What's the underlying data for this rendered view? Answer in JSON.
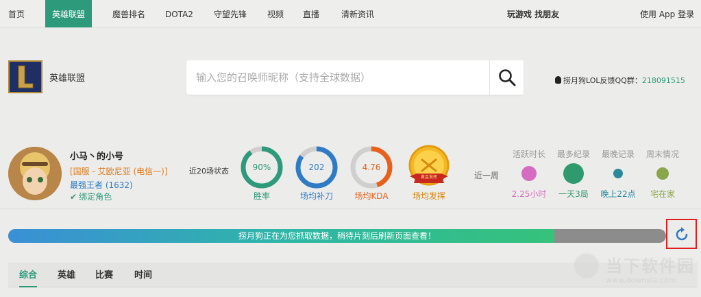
{
  "nav": {
    "items": [
      "首页",
      "英雄联盟",
      "魔兽排名",
      "DOTA2",
      "守望先锋",
      "视频",
      "直播",
      "清新资讯"
    ],
    "active_index": 1,
    "play_link": "玩游戏 找朋友",
    "app_login": "使用 App 登录"
  },
  "header": {
    "game_name": "英雄联盟",
    "search_placeholder": "输入您的召唤师昵称（支持全球数据）",
    "qq_label": "捞月狗LOL反馈QQ群：",
    "qq_number": "218091515"
  },
  "player": {
    "name": "小马丶的小号",
    "server": "[国服 - 艾欧尼亚 (电信一)]",
    "rank": "最强王者 (1632)",
    "bind": "绑定角色"
  },
  "stats": {
    "recent_label": "近20场状态",
    "win_rate": {
      "value": "90%",
      "label": "胜率",
      "fraction": 0.9,
      "color": "#2d9a7b"
    },
    "cs": {
      "value": "202",
      "label": "场均补刀",
      "fraction": 0.85,
      "color": "#2f7cc4"
    },
    "kda": {
      "value": "4.76",
      "label": "场均KDA",
      "fraction": 0.45,
      "color": "#e8601c"
    },
    "medal": {
      "label": "场均发挥",
      "badge_text": "黄金发挥"
    }
  },
  "week": {
    "label": "近一周",
    "columns": [
      {
        "head": "活跃时长",
        "value": "2.25小时",
        "color": "#d66cc0"
      },
      {
        "head": "最多纪录",
        "value": "一天3局",
        "color": "#2f9a6e"
      },
      {
        "head": "最晚记录",
        "value": "晚上22点",
        "color": "#2a8a9a"
      },
      {
        "head": "周末情况",
        "value": "宅在家",
        "color": "#8aa64a"
      }
    ]
  },
  "progress": {
    "text": "捞月狗正在为您抓取数据，稍待片刻后刷新页面查看！",
    "fraction": 0.83
  },
  "tabs": [
    "综合",
    "英雄",
    "比赛",
    "时间"
  ],
  "watermark": {
    "title": "当下软件园",
    "url": "www.downxia.com"
  }
}
